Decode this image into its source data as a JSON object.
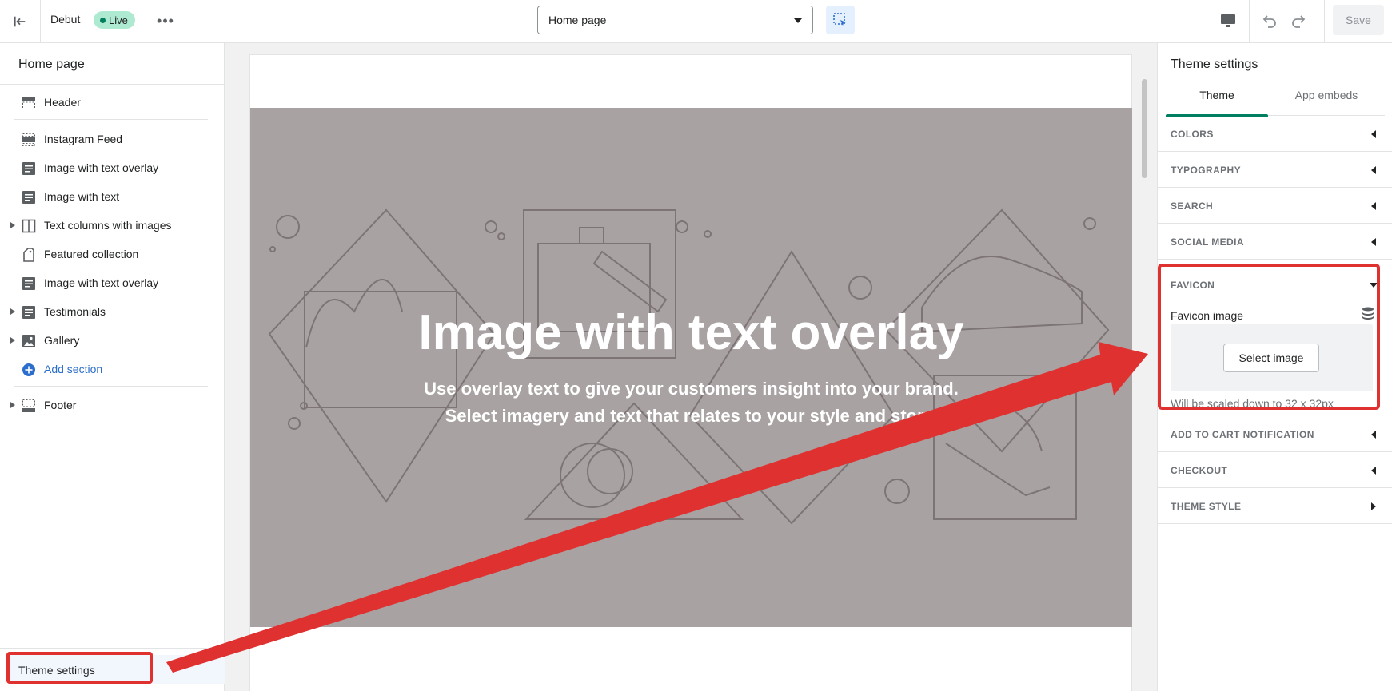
{
  "topbar": {
    "theme_name": "Debut",
    "status_badge": "Live",
    "more_label": "•••",
    "page_select_value": "Home page",
    "save_label": "Save"
  },
  "left_sidebar": {
    "title": "Home page",
    "sections": [
      {
        "label": "Header",
        "icon": "header-icon"
      },
      {
        "label": "Instagram Feed",
        "icon": "section-icon"
      },
      {
        "label": "Image with text overlay",
        "icon": "text-block-icon"
      },
      {
        "label": "Image with text",
        "icon": "text-block-icon"
      },
      {
        "label": "Text columns with images",
        "icon": "columns-icon"
      },
      {
        "label": "Featured collection",
        "icon": "tag-icon"
      },
      {
        "label": "Image with text overlay",
        "icon": "text-block-icon"
      },
      {
        "label": "Testimonials",
        "icon": "text-block-icon"
      },
      {
        "label": "Gallery",
        "icon": "image-icon"
      },
      {
        "label": "Add section",
        "icon": "add-circle-icon"
      },
      {
        "label": "Footer",
        "icon": "footer-icon"
      }
    ],
    "theme_settings_label": "Theme settings"
  },
  "preview": {
    "hero_title": "Image with text overlay",
    "hero_subtitle_line1": "Use overlay text to give your customers insight into your brand.",
    "hero_subtitle_line2": "Select imagery and text that relates to your style and story.",
    "hero_bg_color": "#a9a2a2"
  },
  "right_sidebar": {
    "title": "Theme settings",
    "tabs": [
      {
        "label": "Theme",
        "active": true
      },
      {
        "label": "App embeds",
        "active": false
      }
    ],
    "accordions": [
      {
        "label": "COLORS"
      },
      {
        "label": "TYPOGRAPHY"
      },
      {
        "label": "SEARCH"
      },
      {
        "label": "SOCIAL MEDIA"
      }
    ],
    "favicon": {
      "label": "FAVICON",
      "field_label": "Favicon image",
      "select_button": "Select image",
      "help_text": "Will be scaled down to 32 x 32px"
    },
    "accordions_after": [
      {
        "label": "ADD TO CART NOTIFICATION"
      },
      {
        "label": "CHECKOUT"
      },
      {
        "label": "THEME STYLE"
      }
    ]
  },
  "colors": {
    "accent_green": "#008060",
    "highlight_red": "#e03131",
    "live_badge_bg": "#aee9d1",
    "link_blue": "#2c6ecb"
  }
}
